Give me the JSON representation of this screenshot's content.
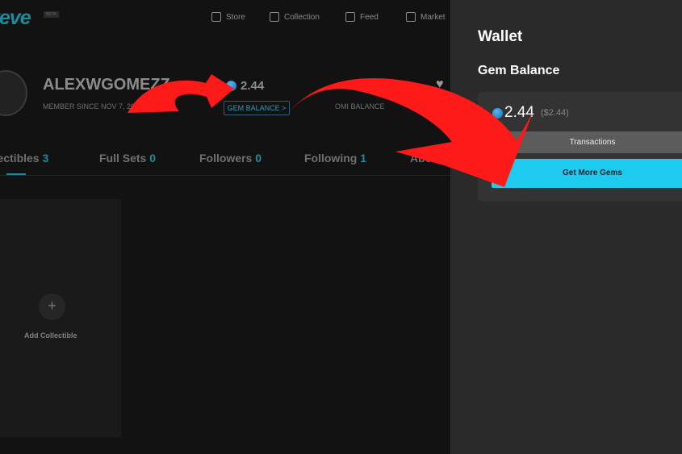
{
  "header": {
    "logo": "veve",
    "beta": "BETA",
    "nav": [
      {
        "label": "Store",
        "icon": "tag-icon"
      },
      {
        "label": "Collection",
        "icon": "archive-icon"
      },
      {
        "label": "Feed",
        "icon": "feed-icon"
      },
      {
        "label": "Market",
        "icon": "store-icon"
      }
    ]
  },
  "profile": {
    "username": "ALEXWGOMEZZ",
    "member_since": "MEMBER SINCE NOV 7, 2021",
    "gem_value": "2.44",
    "gem_balance_label": "GEM BALANCE >",
    "omi_balance_label": "OMI BALANCE"
  },
  "tabs": [
    {
      "label": "Collectibles",
      "count": "3"
    },
    {
      "label": "Full Sets",
      "count": "0"
    },
    {
      "label": "Followers",
      "count": "0"
    },
    {
      "label": "Following",
      "count": "1"
    },
    {
      "label": "About",
      "count": ""
    }
  ],
  "collection": {
    "add_label": "Add Collectible",
    "plus": "+"
  },
  "wallet": {
    "title": "Wallet",
    "section": "Gem Balance",
    "balance": "2.44",
    "usd": "($2.44)",
    "transactions": "Transactions",
    "get_more": "Get More Gems"
  },
  "colors": {
    "accent": "#1ecbee",
    "annotation": "#ff1a1a"
  }
}
